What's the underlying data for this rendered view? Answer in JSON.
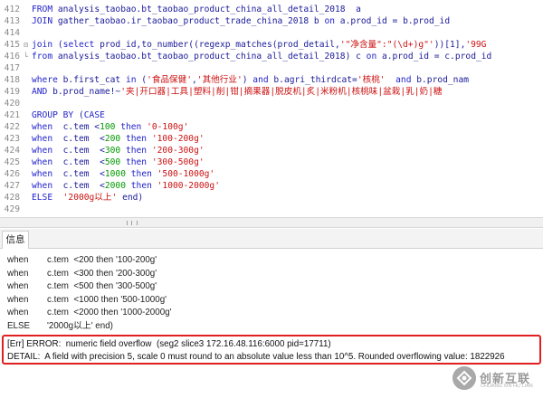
{
  "editor": {
    "lines": [
      {
        "no": "412",
        "fold": "",
        "segments": [
          [
            "kw",
            "FROM "
          ],
          [
            "txt",
            "analysis_taobao.bt_taobao_product_china_all_detail_2018  "
          ],
          [
            "txt",
            "a"
          ]
        ]
      },
      {
        "no": "413",
        "fold": "",
        "segments": [
          [
            "kw",
            "JOIN "
          ],
          [
            "txt",
            "gather_taobao.ir_taobao_product_trade_china_2018 b "
          ],
          [
            "kw",
            "on "
          ],
          [
            "txt",
            "a.prod_id = b.prod_id"
          ]
        ]
      },
      {
        "no": "414",
        "fold": "",
        "segments": []
      },
      {
        "no": "415",
        "fold": "⊟",
        "segments": [
          [
            "kw",
            "join "
          ],
          [
            "txt",
            "("
          ],
          [
            "kw",
            "select "
          ],
          [
            "txt",
            "prod_id,to_number((regexp_matches(prod_detail,"
          ],
          [
            "str",
            "'\"净含量\":\"(\\d+)g\"'"
          ],
          [
            "txt",
            "))[1],"
          ],
          [
            "str",
            "'99G"
          ]
        ]
      },
      {
        "no": "416",
        "fold": "└",
        "segments": [
          [
            "kw",
            "from "
          ],
          [
            "txt",
            "analysis_taobao.bt_taobao_product_china_all_detail_2018) c "
          ],
          [
            "kw",
            "on "
          ],
          [
            "txt",
            "a.prod_id = c.prod_id"
          ]
        ]
      },
      {
        "no": "417",
        "fold": "",
        "segments": []
      },
      {
        "no": "418",
        "fold": "",
        "segments": [
          [
            "kw",
            "where "
          ],
          [
            "txt",
            "b.first_cat "
          ],
          [
            "kw",
            "in "
          ],
          [
            "txt",
            "("
          ],
          [
            "str",
            "'食品保健'"
          ],
          [
            "txt",
            ","
          ],
          [
            "str",
            "'其他行业'"
          ],
          [
            "txt",
            ") "
          ],
          [
            "kw",
            "and "
          ],
          [
            "txt",
            "b.agri_thirdcat="
          ],
          [
            "str",
            "'核桃'"
          ],
          [
            "txt",
            "  "
          ],
          [
            "kw",
            "and "
          ],
          [
            "txt",
            "b.prod_nam"
          ]
        ]
      },
      {
        "no": "419",
        "fold": "",
        "segments": [
          [
            "kw",
            "AND "
          ],
          [
            "txt",
            "b.prod_name!~"
          ],
          [
            "str",
            "'夹|开口器|工具|塑料|削|钳|摘果器|脱皮机|炙|米粉机|核桃味|盆栽|乳|奶|糖"
          ]
        ]
      },
      {
        "no": "420",
        "fold": "",
        "segments": []
      },
      {
        "no": "421",
        "fold": "",
        "segments": [
          [
            "kw",
            "GROUP BY "
          ],
          [
            "txt",
            "("
          ],
          [
            "kw",
            "CASE"
          ]
        ]
      },
      {
        "no": "422",
        "fold": "",
        "segments": [
          [
            "kw",
            "when  "
          ],
          [
            "txt",
            "c.tem <"
          ],
          [
            "num",
            "100 "
          ],
          [
            "kw",
            "then "
          ],
          [
            "str",
            "'0-100g'"
          ]
        ]
      },
      {
        "no": "423",
        "fold": "",
        "segments": [
          [
            "kw",
            "when  "
          ],
          [
            "txt",
            "c.tem  <"
          ],
          [
            "num",
            "200 "
          ],
          [
            "kw",
            "then "
          ],
          [
            "str",
            "'100-200g'"
          ]
        ]
      },
      {
        "no": "424",
        "fold": "",
        "segments": [
          [
            "kw",
            "when  "
          ],
          [
            "txt",
            "c.tem  <"
          ],
          [
            "num",
            "300 "
          ],
          [
            "kw",
            "then "
          ],
          [
            "str",
            "'200-300g'"
          ]
        ]
      },
      {
        "no": "425",
        "fold": "",
        "segments": [
          [
            "kw",
            "when  "
          ],
          [
            "txt",
            "c.tem  <"
          ],
          [
            "num",
            "500 "
          ],
          [
            "kw",
            "then "
          ],
          [
            "str",
            "'300-500g'"
          ]
        ]
      },
      {
        "no": "426",
        "fold": "",
        "segments": [
          [
            "kw",
            "when  "
          ],
          [
            "txt",
            "c.tem  <"
          ],
          [
            "num",
            "1000 "
          ],
          [
            "kw",
            "then "
          ],
          [
            "str",
            "'500-1000g'"
          ]
        ]
      },
      {
        "no": "427",
        "fold": "",
        "segments": [
          [
            "kw",
            "when  "
          ],
          [
            "txt",
            "c.tem  <"
          ],
          [
            "num",
            "2000 "
          ],
          [
            "kw",
            "then "
          ],
          [
            "str",
            "'1000-2000g'"
          ]
        ]
      },
      {
        "no": "428",
        "fold": "",
        "segments": [
          [
            "kw",
            "ELSE  "
          ],
          [
            "str",
            "'2000g以上' "
          ],
          [
            "txt",
            "end)"
          ]
        ]
      },
      {
        "no": "429",
        "fold": "",
        "segments": []
      }
    ]
  },
  "output": {
    "tab_label": "信息",
    "lines": [
      {
        "kw": "when",
        "rest": "c.tem  <200 then '100-200g'"
      },
      {
        "kw": "when",
        "rest": "c.tem  <300 then '200-300g'"
      },
      {
        "kw": "when",
        "rest": "c.tem  <500 then '300-500g'"
      },
      {
        "kw": "when",
        "rest": "c.tem  <1000 then '500-1000g'"
      },
      {
        "kw": "when",
        "rest": "c.tem  <2000 then '1000-2000g'"
      },
      {
        "kw": "ELSE",
        "rest": "'2000g以上' end)"
      }
    ],
    "error": {
      "line1": "[Err] ERROR:  numeric field overflow  (seg2 slice3 172.16.48.116:6000 pid=17711)",
      "line2": "DETAIL:  A field with precision 5, scale 0 must round to an absolute value less than 10^5. Rounded overflowing value: 1822926"
    }
  },
  "watermark": {
    "text": "创新互联",
    "sub": "CHUANG XIN HU LIAN",
    "icon": "brand-logo-icon"
  },
  "colors": {
    "keyword": "#2222cc",
    "string": "#cc1111",
    "number": "#009900",
    "error_border": "#e02020"
  }
}
